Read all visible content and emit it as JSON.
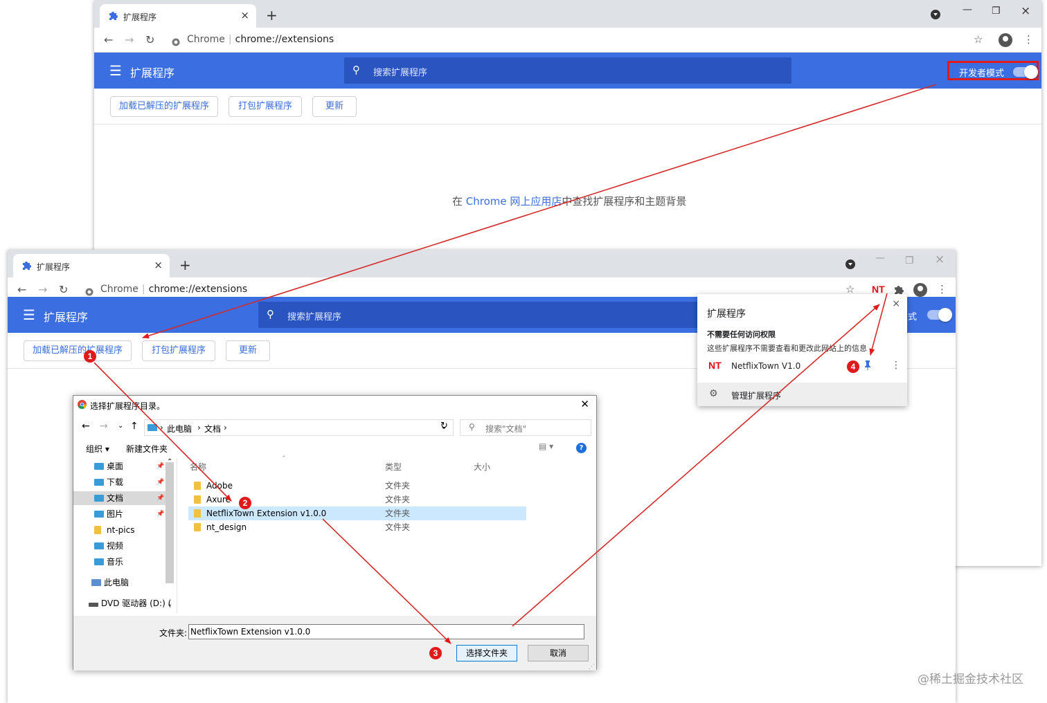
{
  "back_window": {
    "tab_title": "扩展程序",
    "url_prefix": "Chrome",
    "url": "chrome://extensions",
    "page_title": "扩展程序",
    "search_placeholder": "搜索扩展程序",
    "dev_mode_label": "开发者模式",
    "buttons": [
      "加载已解压的扩展程序",
      "打包扩展程序",
      "更新"
    ],
    "store_text": {
      "before": "在 ",
      "link": "Chrome 网上应用店",
      "after": "中查找扩展程序和主题背景"
    }
  },
  "front_window": {
    "tab_title": "扩展程序",
    "url_prefix": "Chrome",
    "url": "chrome://extensions",
    "page_title": "扩展程序",
    "search_placeholder": "搜索扩展程序",
    "dev_mode_partial": "式",
    "buttons": [
      "加载已解压的扩展程序",
      "打包扩展程序",
      "更新"
    ],
    "toolbar_ext_badge": "NT"
  },
  "ext_popup": {
    "title": "扩展程序",
    "section_title": "不需要任何访问权限",
    "section_desc": "这些扩展程序不需要查看和更改此网站上的信息",
    "ext_logo": "NT",
    "ext_name": "NetflixTown V1.0",
    "manage_label": "管理扩展程序"
  },
  "dialog": {
    "title": "选择扩展程序目录。",
    "path": [
      "此电脑",
      "文档"
    ],
    "search_placeholder": "搜索\"文档\"",
    "organize": "组织 ▾",
    "new_folder": "新建文件夹",
    "tree": [
      "桌面",
      "下载",
      "文档",
      "图片",
      "nt-pics",
      "视频",
      "音乐",
      "此电脑",
      "DVD 驱动器 (D:) ("
    ],
    "columns": [
      "名称",
      "类型",
      "大小"
    ],
    "files": [
      {
        "name": "Adobe",
        "type": "文件夹"
      },
      {
        "name": "Axure",
        "type": "文件夹"
      },
      {
        "name": "NetflixTown Extension v1.0.0",
        "type": "文件夹"
      },
      {
        "name": "nt_design",
        "type": "文件夹"
      }
    ],
    "folder_label": "文件夹:",
    "folder_value": "NetflixTown Extension v1.0.0",
    "select_button": "选择文件夹",
    "cancel_button": "取消"
  },
  "steps": [
    "1",
    "2",
    "3",
    "4"
  ],
  "watermark": "@稀土掘金技术社区",
  "colors": {
    "chrome_blue": "#3b6ee0",
    "annotation_red": "#e0191b",
    "netflix_red": "#e50914"
  },
  "icons": [
    "puzzle-icon",
    "search-icon",
    "star-icon",
    "profile-icon",
    "pin-icon",
    "gear-icon",
    "folder-icon",
    "help-icon"
  ]
}
